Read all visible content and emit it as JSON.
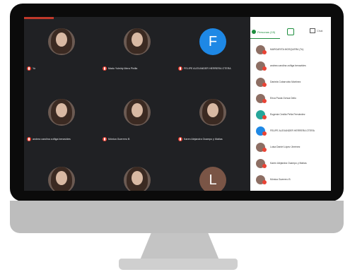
{
  "tiles": [
    {
      "name": "Yo",
      "avatar": "photo",
      "letter": ""
    },
    {
      "name": "Madu Yuleidy Mera Pinilla",
      "avatar": "photo",
      "letter": ""
    },
    {
      "name": "FELIPE ALEXANDER HERRERA OTERA",
      "avatar": "letter",
      "letter": "F"
    },
    {
      "name": "andrea carolina zuñiga benavides",
      "avatar": "photo",
      "letter": ""
    },
    {
      "name": "Mónica Guerrero B",
      "avatar": "photo",
      "letter": ""
    },
    {
      "name": "Karen Alejandra Ocampo y Matías",
      "avatar": "photo",
      "letter": ""
    },
    {
      "name": "",
      "avatar": "photo",
      "letter": ""
    },
    {
      "name": "",
      "avatar": "photo",
      "letter": ""
    },
    {
      "name": "",
      "avatar": "letter",
      "letter": "L"
    }
  ],
  "panel": {
    "tab_people": "Personas (15)",
    "tab_chat": "Chat"
  },
  "participants": [
    {
      "name": "MARGARITA MOSQUERA (Tú)",
      "avatar": "photo"
    },
    {
      "name": "andrea carolina zuñiga benavides",
      "avatar": "photo"
    },
    {
      "name": "Daniela Cobarrubio Martínez",
      "avatar": "photo"
    },
    {
      "name": "Erica Paola Ochoa Delio",
      "avatar": "photo"
    },
    {
      "name": "Eugenia Cecilia Peña Fernández",
      "avatar": "teal"
    },
    {
      "name": "FELIPE ALEXANDER HERRERA OTERA",
      "avatar": "blue"
    },
    {
      "name": "Luisa Daniel López Jiménez",
      "avatar": "photo"
    },
    {
      "name": "Karen Alejandra Ocampo y Matías",
      "avatar": "photo"
    },
    {
      "name": "Mónica Guerrero B",
      "avatar": "photo"
    }
  ]
}
